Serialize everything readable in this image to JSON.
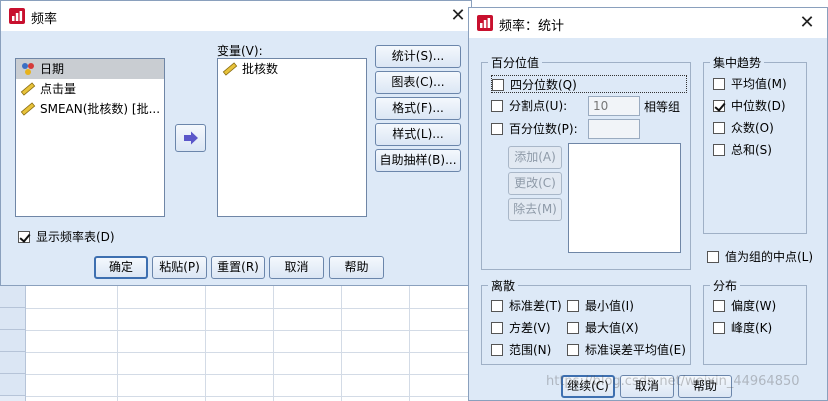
{
  "freq_dialog": {
    "title": "频率",
    "source_list": [
      {
        "label": "日期",
        "icon": "nominal-variable-icon",
        "selected": true
      },
      {
        "label": "点击量",
        "icon": "scale-variable-icon",
        "selected": false
      },
      {
        "label": "SMEAN(批核数) [批...",
        "icon": "scale-variable-icon",
        "selected": false
      }
    ],
    "variables_label": "变量(V):",
    "target_list": [
      {
        "label": "批核数",
        "icon": "scale-variable-icon"
      }
    ],
    "side_buttons": [
      "统计(S)...",
      "图表(C)...",
      "格式(F)...",
      "样式(L)...",
      "自助抽样(B)..."
    ],
    "show_freq_label": "显示频率表(D)",
    "bottom_buttons": [
      "确定",
      "粘贴(P)",
      "重置(R)",
      "取消",
      "帮助"
    ]
  },
  "stats_dialog": {
    "title": "频率：统计",
    "percentile_group": {
      "title": "百分位值",
      "quartiles_label": "四分位数(Q)",
      "cut_points_label": "分割点(U):",
      "cut_points_value": "10",
      "equal_groups_label": "相等组",
      "percentiles_label": "百分位数(P):",
      "buttons": [
        "添加(A)",
        "更改(C)",
        "除去(M)"
      ]
    },
    "central_group": {
      "title": "集中趋势",
      "items": [
        {
          "label": "平均值(M)",
          "checked": false
        },
        {
          "label": "中位数(D)",
          "checked": true
        },
        {
          "label": "众数(O)",
          "checked": false
        },
        {
          "label": "总和(S)",
          "checked": false
        }
      ]
    },
    "midpoint_label": "值为组的中点(L)",
    "dispersion_group": {
      "title": "离散",
      "items": [
        {
          "label": "标准差(T)"
        },
        {
          "label": "最小值(I)"
        },
        {
          "label": "方差(V)"
        },
        {
          "label": "最大值(X)"
        },
        {
          "label": "范围(N)"
        },
        {
          "label": "标准误差平均值(E)"
        }
      ]
    },
    "distribution_group": {
      "title": "分布",
      "items": [
        {
          "label": "偏度(W)"
        },
        {
          "label": "峰度(K)"
        }
      ]
    },
    "bottom_buttons": [
      "继续(C)",
      "取消",
      "帮助"
    ]
  },
  "watermark": "https://blog.csdn.net/weixin_44964850"
}
